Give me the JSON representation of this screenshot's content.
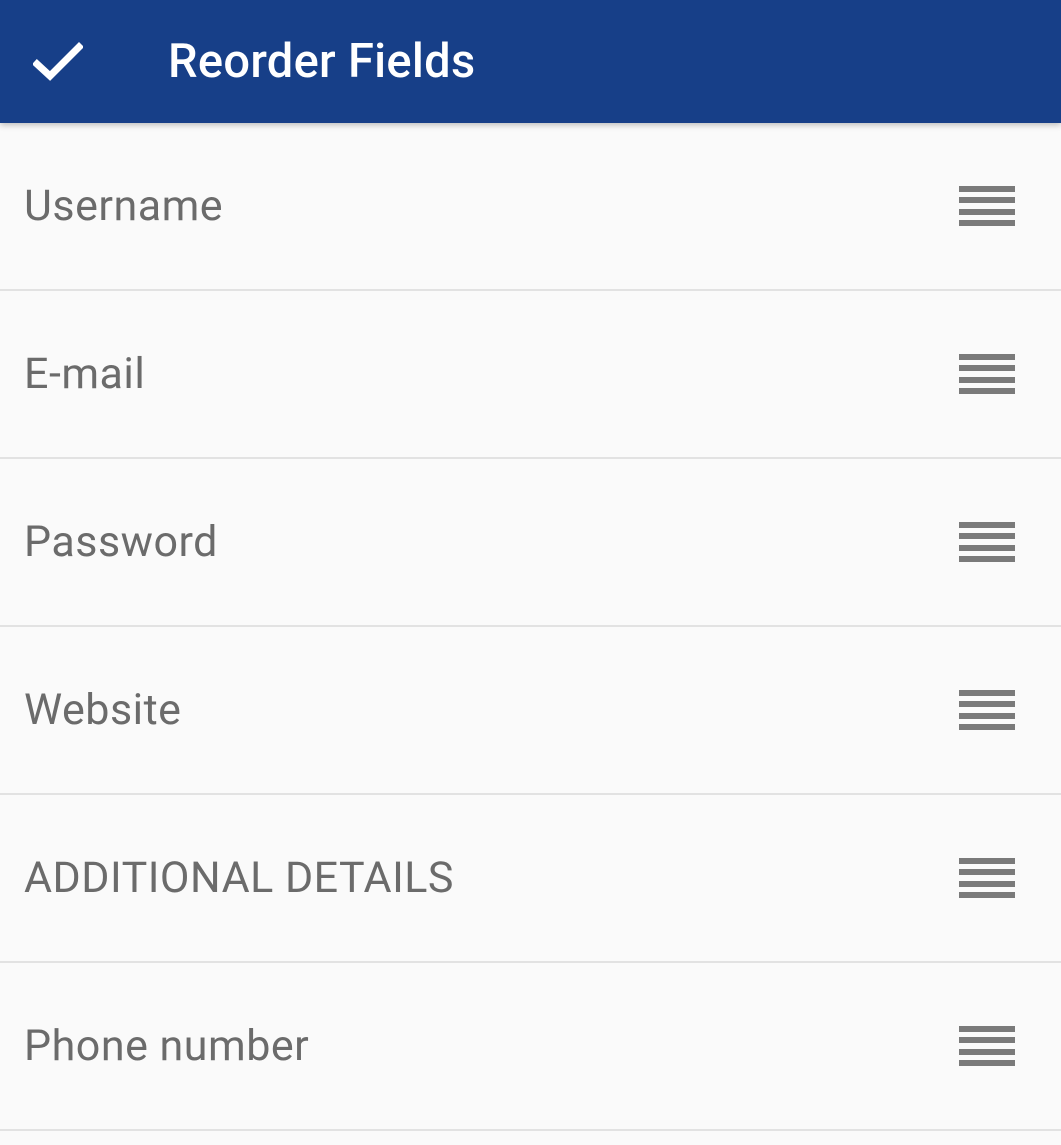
{
  "header": {
    "title": "Reorder Fields"
  },
  "fields": {
    "items": [
      {
        "label": "Username"
      },
      {
        "label": "E-mail"
      },
      {
        "label": "Password"
      },
      {
        "label": "Website"
      },
      {
        "label": "ADDITIONAL DETAILS"
      },
      {
        "label": "Phone number"
      }
    ]
  }
}
